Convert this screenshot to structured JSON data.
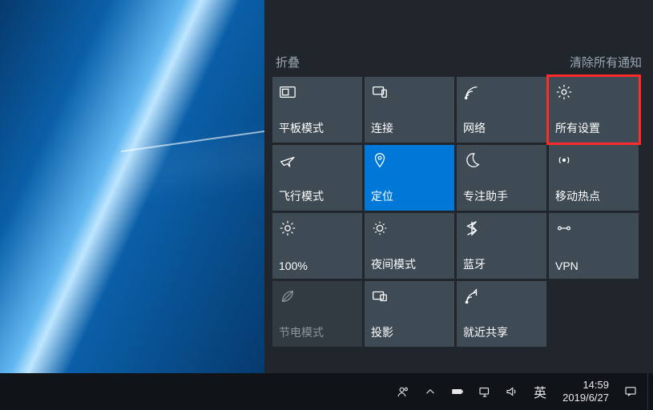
{
  "panel": {
    "collapse": "折叠",
    "clear": "清除所有通知"
  },
  "tiles": [
    {
      "id": "tablet",
      "label": "平板模式"
    },
    {
      "id": "connect",
      "label": "连接"
    },
    {
      "id": "network",
      "label": "网络"
    },
    {
      "id": "settings",
      "label": "所有设置"
    },
    {
      "id": "airplane",
      "label": "飞行模式"
    },
    {
      "id": "location",
      "label": "定位"
    },
    {
      "id": "focus",
      "label": "专注助手"
    },
    {
      "id": "hotspot",
      "label": "移动热点"
    },
    {
      "id": "brightness",
      "label": "100%"
    },
    {
      "id": "nightlight",
      "label": "夜间模式"
    },
    {
      "id": "bluetooth",
      "label": "蓝牙"
    },
    {
      "id": "vpn",
      "label": "VPN"
    },
    {
      "id": "battery",
      "label": "节电模式"
    },
    {
      "id": "project",
      "label": "投影"
    },
    {
      "id": "nearby",
      "label": "就近共享"
    }
  ],
  "taskbar": {
    "ime": "英",
    "time": "14:59",
    "date": "2019/6/27"
  }
}
